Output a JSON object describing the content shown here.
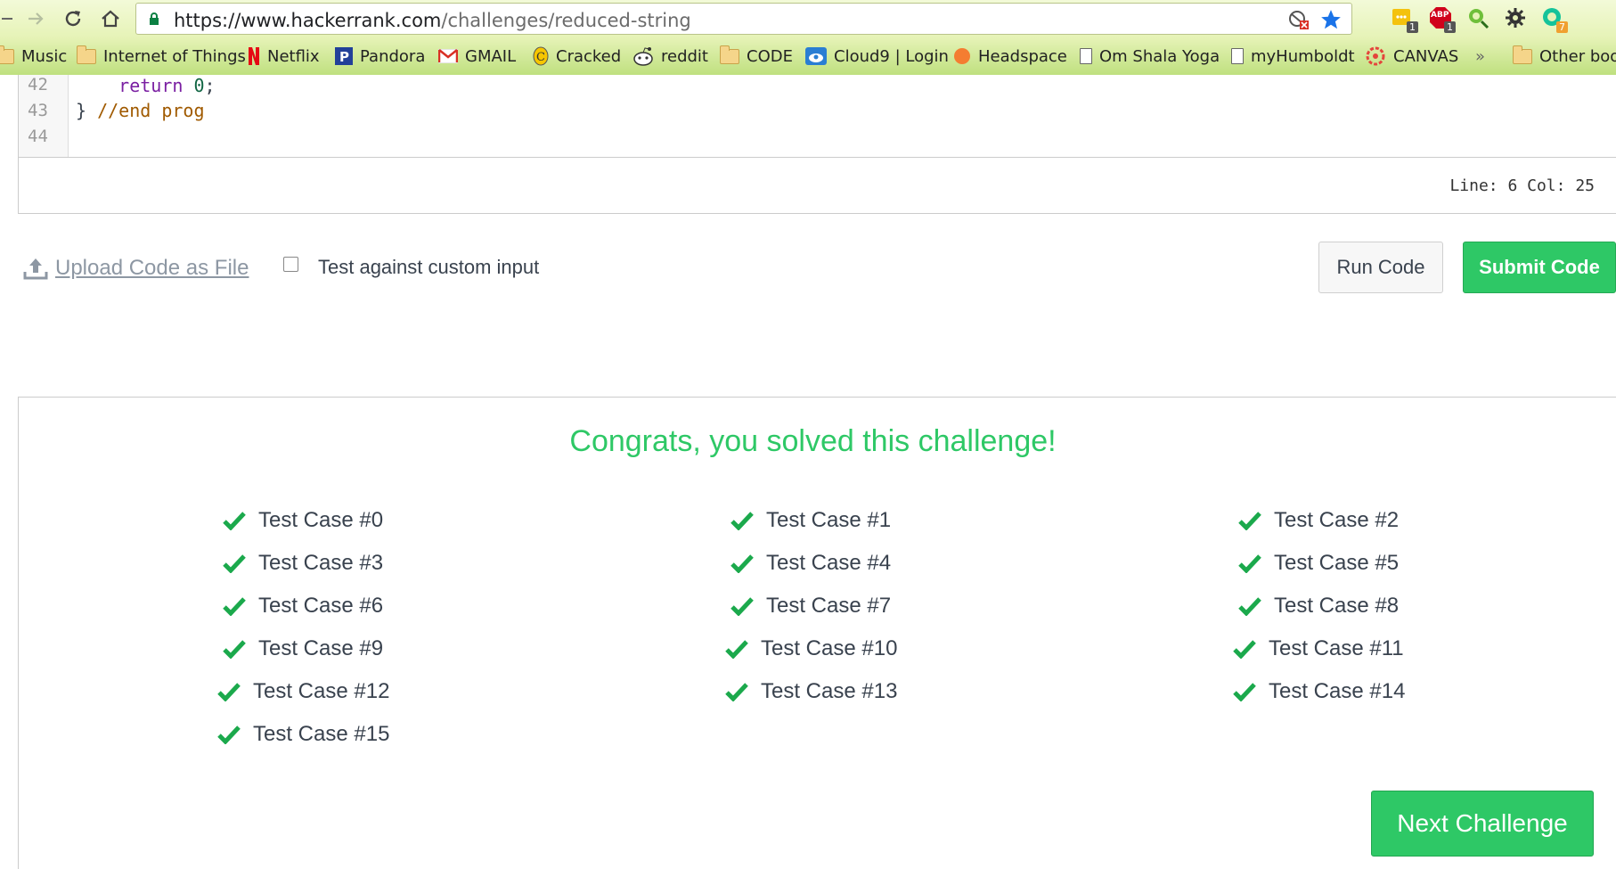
{
  "browser": {
    "url_host": "https://www.hackerrank.com",
    "url_path": "/challenges/reduced-string",
    "extension_badges": [
      "1",
      "1",
      "7"
    ],
    "abp_label": "ABP"
  },
  "bookmarks": [
    {
      "label": "Music",
      "icon": "folder-icon"
    },
    {
      "label": "Internet of Things",
      "icon": "folder-icon"
    },
    {
      "label": "Netflix",
      "icon": "netflix-icon"
    },
    {
      "label": "Pandora",
      "icon": "pandora-icon"
    },
    {
      "label": "GMAIL",
      "icon": "gmail-icon"
    },
    {
      "label": "Cracked",
      "icon": "cracked-icon"
    },
    {
      "label": "reddit",
      "icon": "reddit-icon"
    },
    {
      "label": "CODE",
      "icon": "folder-icon"
    },
    {
      "label": "Cloud9 | Login",
      "icon": "cloud9-icon"
    },
    {
      "label": "Headspace",
      "icon": "headspace-icon"
    },
    {
      "label": "Om Shala Yoga",
      "icon": "page-icon"
    },
    {
      "label": "myHumboldt",
      "icon": "page-icon"
    },
    {
      "label": "CANVAS",
      "icon": "canvas-icon"
    },
    {
      "label": "»",
      "icon": ""
    },
    {
      "label": "Other boo",
      "icon": "folder-icon"
    }
  ],
  "editor": {
    "lines": [
      {
        "num": "42",
        "parts": [
          {
            "t": "    "
          },
          {
            "t": "return",
            "c": "kw"
          },
          {
            "t": " "
          },
          {
            "t": "0",
            "c": "num"
          },
          {
            "t": ";"
          }
        ]
      },
      {
        "num": "43",
        "parts": [
          {
            "t": "} "
          },
          {
            "t": "//end prog",
            "c": "cmt"
          }
        ]
      },
      {
        "num": "44",
        "parts": []
      }
    ],
    "status": "Line: 6 Col: 25"
  },
  "actions": {
    "upload_label": "Upload Code as File",
    "custom_input_label": "Test against custom input",
    "run_label": "Run Code",
    "submit_label": "Submit Code"
  },
  "result": {
    "message": "Congrats, you solved this challenge!",
    "test_cases": [
      "Test Case #0",
      "Test Case #1",
      "Test Case #2",
      "Test Case #3",
      "Test Case #4",
      "Test Case #5",
      "Test Case #6",
      "Test Case #7",
      "Test Case #8",
      "Test Case #9",
      "Test Case #10",
      "Test Case #11",
      "Test Case #12",
      "Test Case #13",
      "Test Case #14",
      "Test Case #15"
    ],
    "next_label": "Next Challenge"
  },
  "colors": {
    "accent_green": "#2ec866",
    "check_green": "#1ba94c"
  }
}
